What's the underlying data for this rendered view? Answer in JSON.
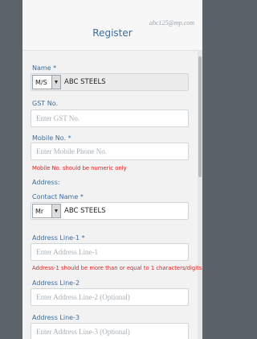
{
  "modal": {
    "title": "Register",
    "watermark": "abc125@mp.com"
  },
  "form": {
    "name_label": "Name *",
    "name_prefix": "M/S",
    "name_value": "ABC STEELS",
    "gst_label": "GST No.",
    "gst_placeholder": "Enter GST No.",
    "mobile_label": "Mobile No. *",
    "mobile_placeholder": "Enter Mobile Phone No.",
    "mobile_error": "Mobile No. should be numeric only",
    "address_label": "Address:",
    "contact_label": "Contact Name *",
    "contact_prefix": "Mr",
    "contact_value": "ABC STEELS",
    "addr1_label": "Address Line-1 *",
    "addr1_placeholder": "Enter Address Line-1",
    "addr1_error": "Address-1 should be more than or equal to 1 characters/digits",
    "addr2_label": "Address Line-2",
    "addr2_placeholder": "Enter Address Line-2 (Optional)",
    "addr3_label": "Address Line-3",
    "addr3_placeholder": "Enter Address Line-3 (Optional)"
  },
  "icons": {
    "dropdown": "chevron-down-icon"
  },
  "colors": {
    "label": "#3a6da0",
    "error": "#dd2222",
    "overlay": "#5a6268",
    "modal_bg": "#f2f2f2"
  }
}
